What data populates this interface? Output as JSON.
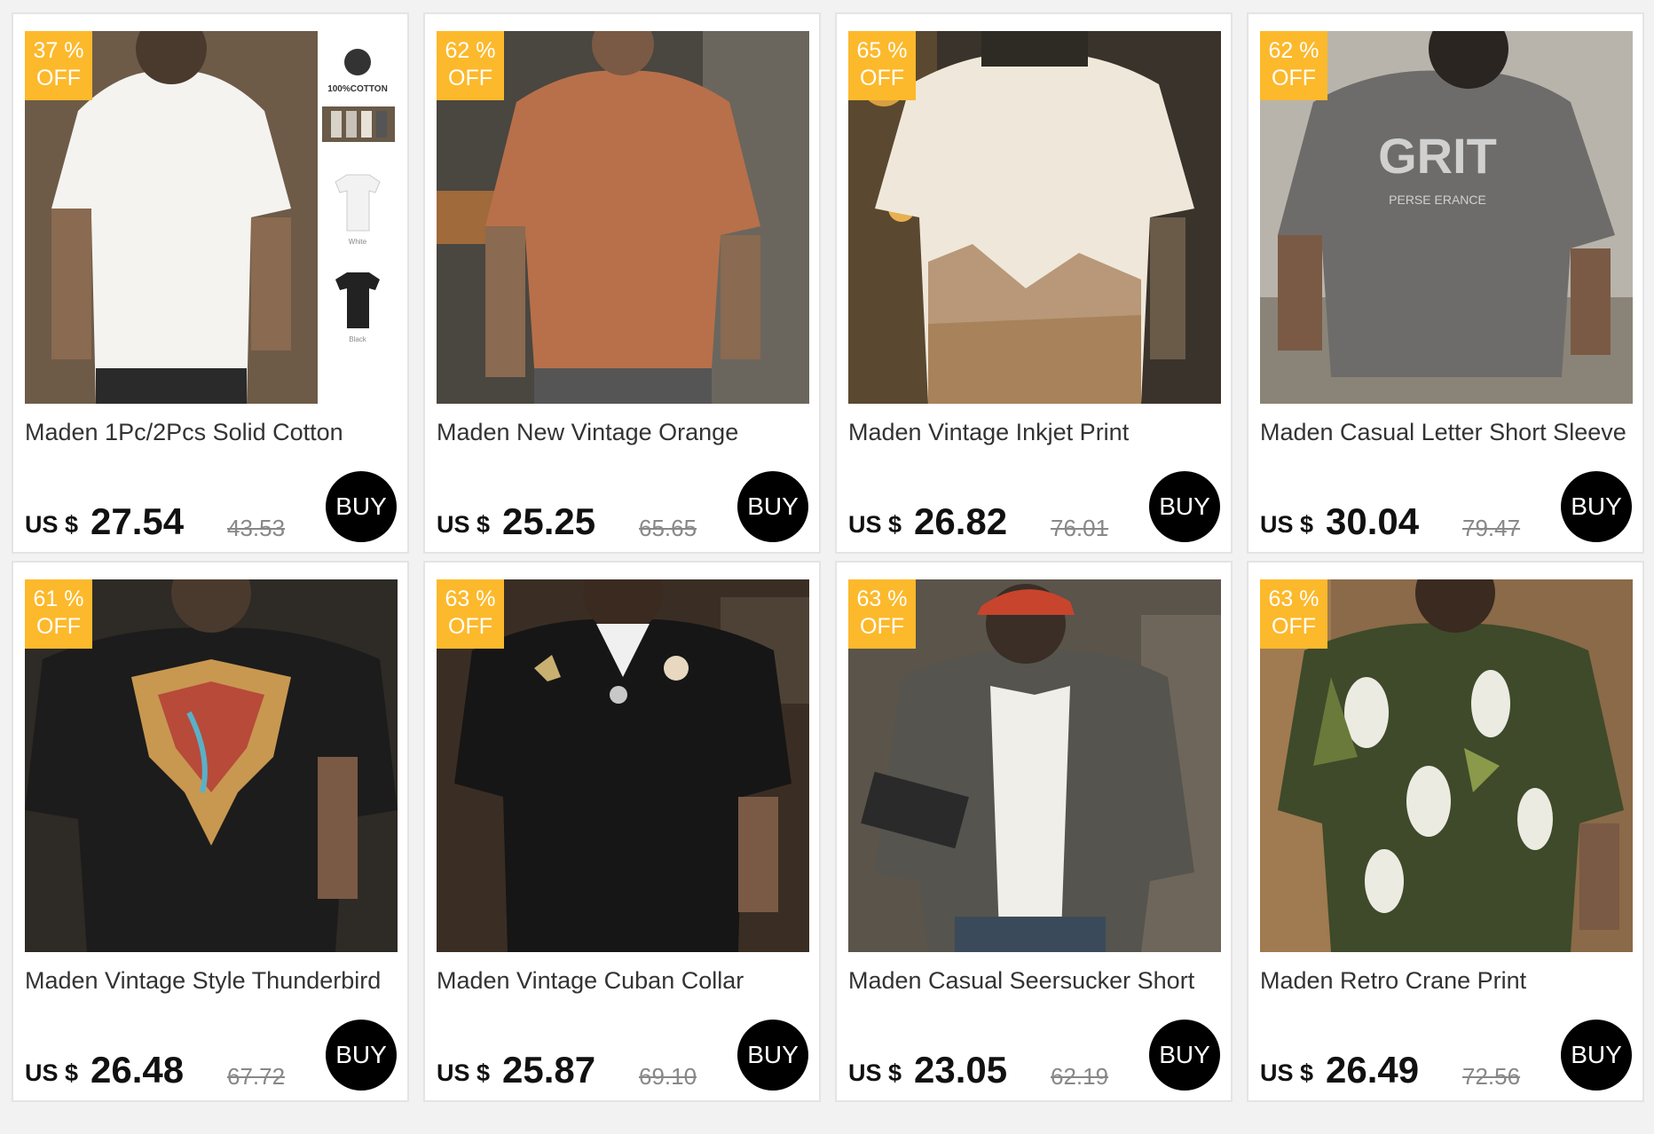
{
  "products": [
    {
      "badge_pct": "37 %",
      "badge_off": "OFF",
      "title": "Maden 1Pc/2Pcs Solid Cotton",
      "currency": "US $",
      "price": "27.54",
      "original_price": "43.53",
      "buy_label": "BUY",
      "cotton_label": "100%COTTON",
      "swatch_white": "White",
      "swatch_black": "Black"
    },
    {
      "badge_pct": "62 %",
      "badge_off": "OFF",
      "title": "Maden New Vintage Orange",
      "currency": "US $",
      "price": "25.25",
      "original_price": "65.65",
      "buy_label": "BUY"
    },
    {
      "badge_pct": "65 %",
      "badge_off": "OFF",
      "title": "Maden Vintage Inkjet Print",
      "currency": "US $",
      "price": "26.82",
      "original_price": "76.01",
      "buy_label": "BUY"
    },
    {
      "badge_pct": "62 %",
      "badge_off": "OFF",
      "title": "Maden Casual Letter Short Sleeve",
      "currency": "US $",
      "price": "30.04",
      "original_price": "79.47",
      "buy_label": "BUY",
      "shirt_text": "GRIT",
      "shirt_subtext": "PERSE ERANCE"
    },
    {
      "badge_pct": "61 %",
      "badge_off": "OFF",
      "title": "Maden Vintage Style Thunderbird",
      "currency": "US $",
      "price": "26.48",
      "original_price": "67.72",
      "buy_label": "BUY"
    },
    {
      "badge_pct": "63 %",
      "badge_off": "OFF",
      "title": "Maden Vintage Cuban Collar",
      "currency": "US $",
      "price": "25.87",
      "original_price": "69.10",
      "buy_label": "BUY"
    },
    {
      "badge_pct": "63 %",
      "badge_off": "OFF",
      "title": "Maden Casual Seersucker Short",
      "currency": "US $",
      "price": "23.05",
      "original_price": "62.19",
      "buy_label": "BUY"
    },
    {
      "badge_pct": "63 %",
      "badge_off": "OFF",
      "title": "Maden Retro Crane Print",
      "currency": "US $",
      "price": "26.49",
      "original_price": "72.56",
      "buy_label": "BUY"
    }
  ],
  "colors": {
    "badge": "#fcb92c",
    "buy_button": "#000000",
    "page_background": "#f2f2f2"
  }
}
